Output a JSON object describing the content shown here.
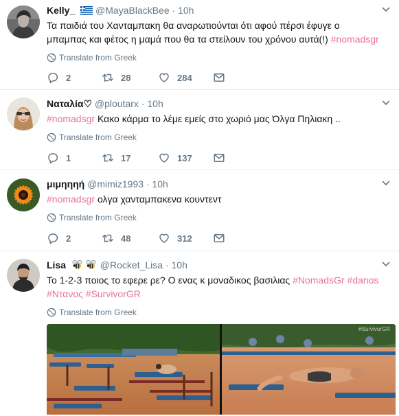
{
  "translate_label": "Translate from Greek",
  "tweets": [
    {
      "name": "Kelly_",
      "handle": "@MayaBlackBee",
      "separator": "·",
      "time": "10h",
      "text_line1": "Τα παιδιά του Χανταμπακη θα αναρωτιούνται ότι αφού πέρσι  έφυγε ο",
      "text_line2": "μπαμπας και φέτος η μαμά που θα τα στείλουν του χρόνου αυτά(!)",
      "hashtag": "#nomadsgr",
      "replies": "2",
      "retweets": "28",
      "likes": "284"
    },
    {
      "name": "Ναταλία♡",
      "handle": "@ploutarx",
      "separator": "·",
      "time": "10h",
      "hashtag": "#nomadsgr",
      "text": "Κακο κάρμα το λέμε εμείς στο χωριό μας Όλγα Πηλιακη ..",
      "replies": "1",
      "retweets": "17",
      "likes": "137"
    },
    {
      "name": "μιμηηηή",
      "handle": "@mimiz1993",
      "separator": "·",
      "time": "10h",
      "hashtag": "#nomadsgr",
      "text": "ολγα χανταμπακενα κουντεντ",
      "replies": "2",
      "retweets": "48",
      "likes": "312"
    },
    {
      "name": "Lisa",
      "handle": "@Rocket_Lisa",
      "separator": "·",
      "time": "10h",
      "text": "Το 1-2-3 ποιος το εφερε ρε? Ο ενας κ μοναδικος βασιλιας",
      "hashtags_line1": [
        "#NomadsGr",
        "#danos"
      ],
      "hashtags_line2": [
        "#Ντανος",
        "#SurvivorGR"
      ],
      "media_watermark": "#SurvivorGR"
    }
  ],
  "colors": {
    "hashtag": "#e5729f",
    "secondary": "#657786",
    "divider": "#e6ecf0"
  },
  "icons": [
    "flag-greece-icon",
    "bee-icon",
    "chevron-down-icon",
    "globe-icon",
    "reply-icon",
    "retweet-icon",
    "heart-icon",
    "envelope-icon"
  ]
}
